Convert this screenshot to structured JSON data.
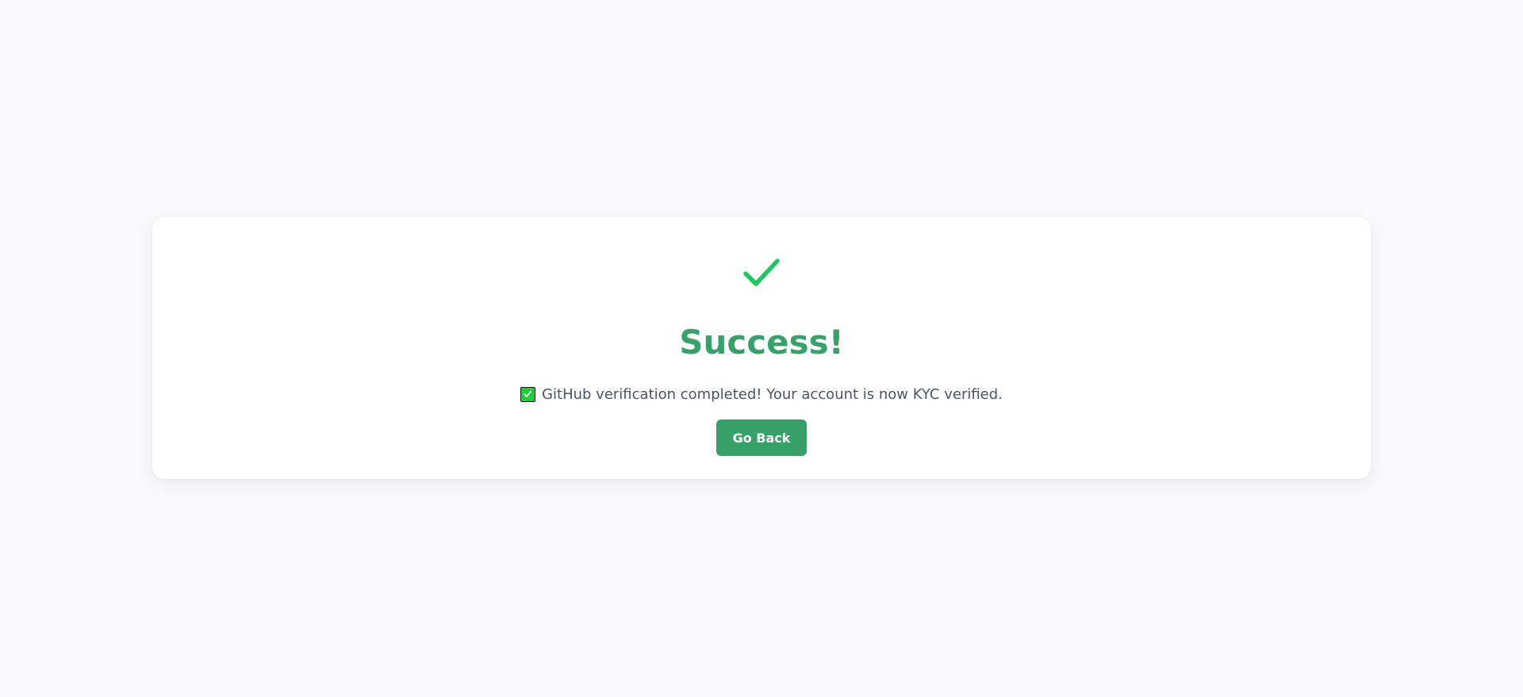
{
  "colors": {
    "background": "#f8f9fa",
    "card": "#ffffff",
    "accent": "#38a169",
    "check_icon": "#22c55e",
    "text": "#4a5568"
  },
  "status": {
    "icon": "checkmark-icon",
    "title": "Success!",
    "message_icon": "green-checkbox-icon",
    "message": "GitHub verification completed! Your account is now KYC verified."
  },
  "actions": {
    "go_back_label": "Go Back"
  }
}
